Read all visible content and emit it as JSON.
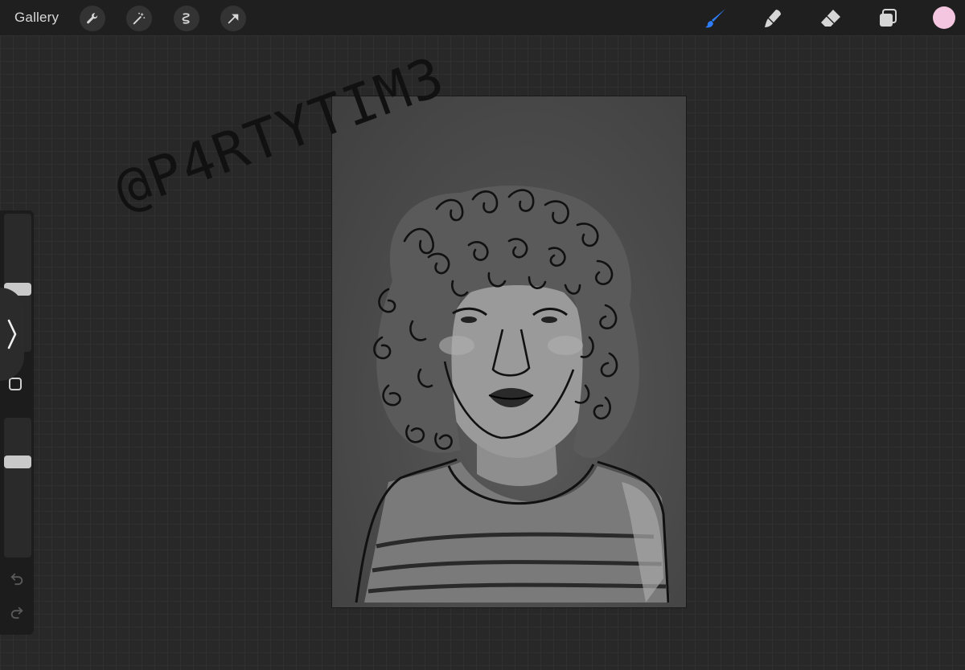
{
  "toolbar": {
    "gallery_label": "Gallery",
    "left_tools": [
      "wrench-icon",
      "magic-wand-icon",
      "selection-icon",
      "transform-arrow-icon"
    ],
    "right_tools": [
      "brush-icon",
      "smudge-icon",
      "eraser-icon",
      "layers-icon"
    ],
    "active_tool": "brush-icon",
    "accent_color": "#2f7df6",
    "current_color": "#f5c6df"
  },
  "sidebar": {
    "brush_size_level": 0.45,
    "opacity_level": 0.7
  },
  "artwork": {
    "watermark": "@P4RTYTIM3"
  }
}
